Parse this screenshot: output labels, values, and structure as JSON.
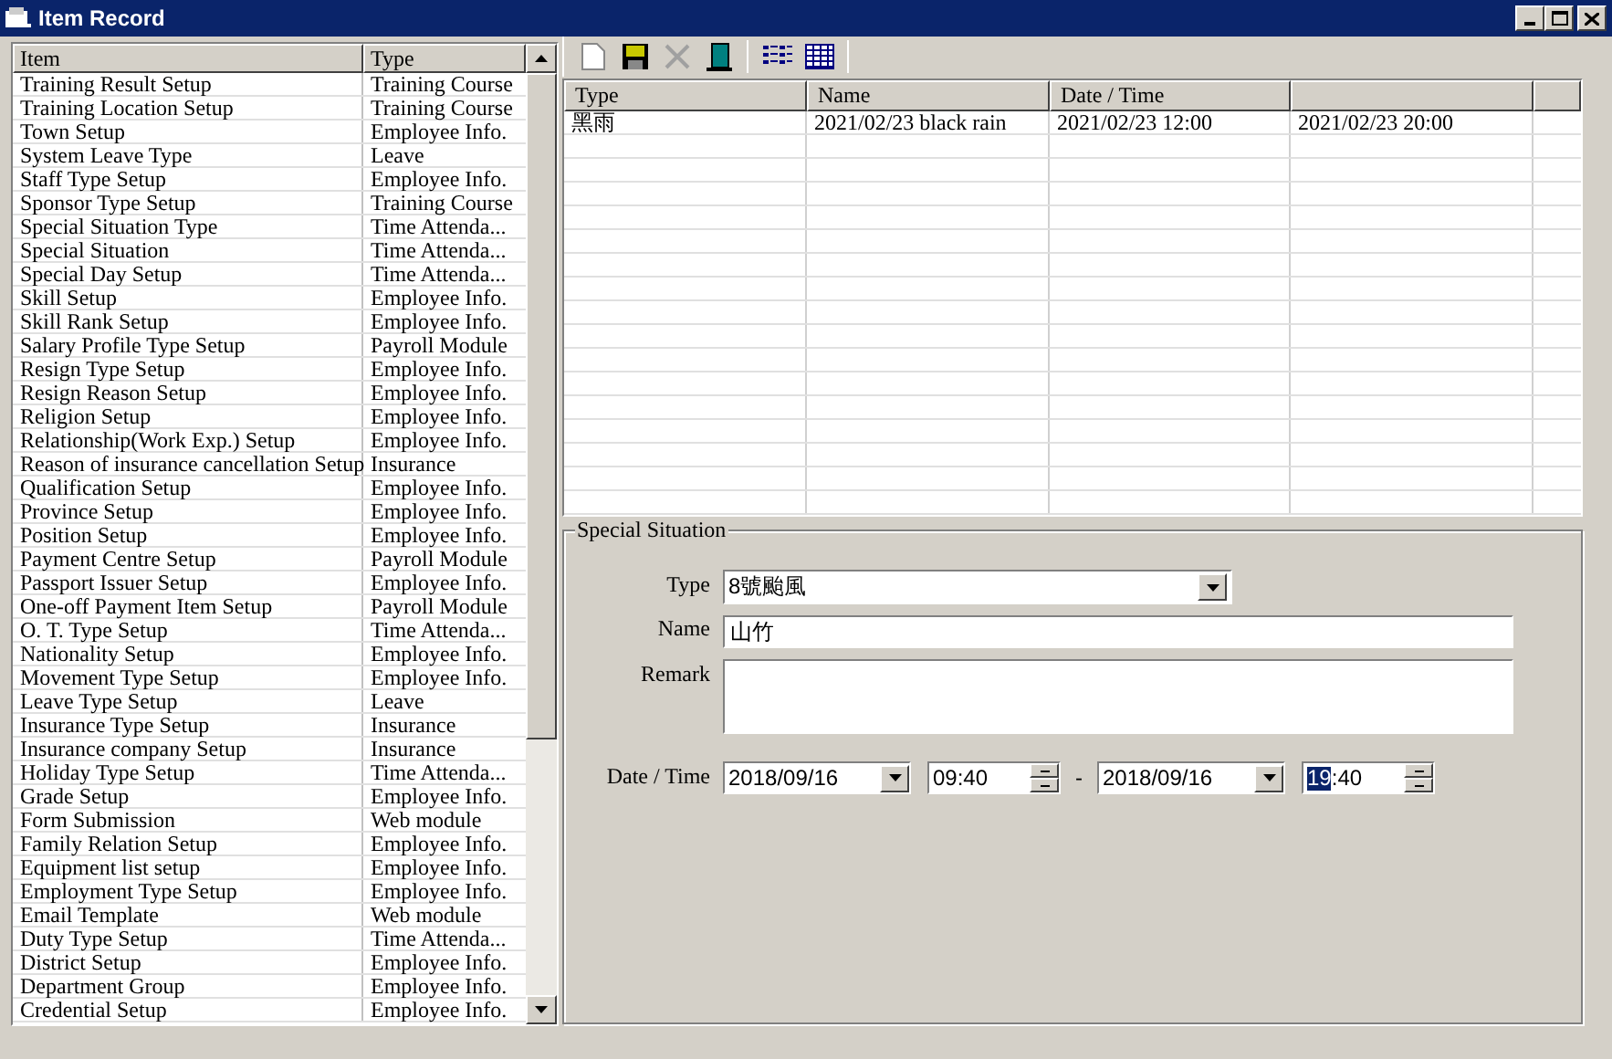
{
  "window": {
    "title": "Item Record"
  },
  "item_list": {
    "columns": [
      "Item",
      "Type"
    ],
    "rows": [
      [
        "Training Result Setup",
        "Training Course"
      ],
      [
        "Training Location Setup",
        "Training Course"
      ],
      [
        "Town Setup",
        "Employee Info."
      ],
      [
        "System Leave Type",
        "Leave"
      ],
      [
        "Staff Type Setup",
        "Employee Info."
      ],
      [
        "Sponsor Type Setup",
        "Training Course"
      ],
      [
        "Special Situation Type",
        "Time Attenda..."
      ],
      [
        "Special Situation",
        "Time Attenda..."
      ],
      [
        "Special Day Setup",
        "Time Attenda..."
      ],
      [
        "Skill Setup",
        "Employee Info."
      ],
      [
        "Skill Rank Setup",
        "Employee Info."
      ],
      [
        "Salary Profile Type Setup",
        "Payroll Module"
      ],
      [
        "Resign Type Setup",
        "Employee Info."
      ],
      [
        "Resign Reason Setup",
        "Employee Info."
      ],
      [
        "Religion Setup",
        "Employee Info."
      ],
      [
        "Relationship(Work Exp.) Setup",
        "Employee Info."
      ],
      [
        "Reason of insurance cancellation Setup",
        "Insurance"
      ],
      [
        "Qualification Setup",
        "Employee Info."
      ],
      [
        "Province Setup",
        "Employee Info."
      ],
      [
        "Position Setup",
        "Employee Info."
      ],
      [
        "Payment Centre Setup",
        "Payroll Module"
      ],
      [
        "Passport Issuer Setup",
        "Employee Info."
      ],
      [
        "One-off Payment Item Setup",
        "Payroll Module"
      ],
      [
        "O. T. Type Setup",
        "Time Attenda..."
      ],
      [
        "Nationality Setup",
        "Employee Info."
      ],
      [
        "Movement Type Setup",
        "Employee Info."
      ],
      [
        "Leave Type Setup",
        "Leave"
      ],
      [
        "Insurance Type Setup",
        "Insurance"
      ],
      [
        "Insurance company Setup",
        "Insurance"
      ],
      [
        "Holiday Type Setup",
        "Time Attenda..."
      ],
      [
        "Grade Setup",
        "Employee Info."
      ],
      [
        "Form Submission",
        "Web module"
      ],
      [
        "Family Relation Setup",
        "Employee Info."
      ],
      [
        "Equipment list setup",
        "Employee Info."
      ],
      [
        "Employment Type Setup",
        "Employee Info."
      ],
      [
        "Email Template",
        "Web module"
      ],
      [
        "Duty Type Setup",
        "Time Attenda..."
      ],
      [
        "District Setup",
        "Employee Info."
      ],
      [
        "Department Group",
        "Employee Info."
      ],
      [
        "Credential Setup",
        "Employee Info."
      ]
    ]
  },
  "toolbar": [
    {
      "kind": "new",
      "disabled": false
    },
    {
      "kind": "save",
      "disabled": false
    },
    {
      "kind": "delete",
      "disabled": true
    },
    {
      "kind": "exit",
      "disabled": false
    },
    {
      "kind": "sep"
    },
    {
      "kind": "list",
      "disabled": false
    },
    {
      "kind": "grid",
      "disabled": false
    }
  ],
  "record_table": {
    "columns": [
      "Type",
      "Name",
      "Date / Time",
      ""
    ],
    "rows": [
      [
        "黑雨",
        "2021/02/23 black rain",
        "2021/02/23 12:00",
        "2021/02/23 20:00"
      ]
    ]
  },
  "form": {
    "title": "Special Situation",
    "type": {
      "label": "Type",
      "value": "8號颱風"
    },
    "name": {
      "label": "Name",
      "value": "山竹"
    },
    "remark": {
      "label": "Remark"
    },
    "date_time": {
      "label": "Date / Time",
      "start_date": "2018/09/16",
      "start_time": "09:40",
      "separator": "-",
      "end_date": "2018/09/16",
      "end_time_selected": "19",
      "end_time_rest": ":40"
    }
  }
}
